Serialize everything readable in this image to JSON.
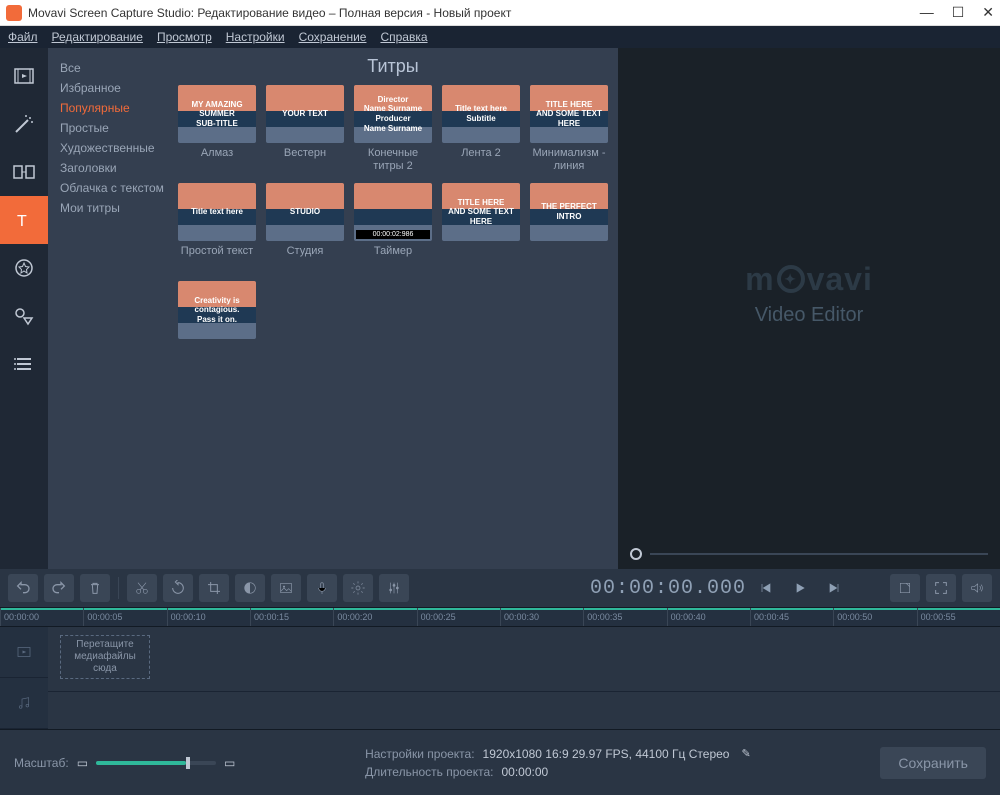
{
  "window": {
    "title": "Movavi Screen Capture Studio: Редактирование видео – Полная версия - Новый проект"
  },
  "menu": [
    "Файл",
    "Редактирование",
    "Просмотр",
    "Настройки",
    "Сохранение",
    "Справка"
  ],
  "rail": [
    {
      "name": "media-icon"
    },
    {
      "name": "wand-icon"
    },
    {
      "name": "transitions-icon"
    },
    {
      "name": "titles-icon",
      "active": true
    },
    {
      "name": "stickers-icon"
    },
    {
      "name": "shapes-icon"
    },
    {
      "name": "list-icon"
    }
  ],
  "categories": {
    "items": [
      "Все",
      "Избранное",
      "Популярные",
      "Простые",
      "Художественные",
      "Заголовки",
      "Облачка с текстом",
      "Мои титры"
    ],
    "selected": 2
  },
  "gallery": {
    "heading": "Титры",
    "thumbs": [
      {
        "overlay": "MY AMAZING SUMMER\\nSUB-TITLE",
        "caption": "Алмаз"
      },
      {
        "overlay": "YOUR TEXT",
        "caption": "Вестерн"
      },
      {
        "overlay": "Director\\nName Surname\\nProducer\\nName Surname",
        "caption": "Конечные титры 2"
      },
      {
        "overlay": "Title text here\\nSubtitle",
        "caption": "Лента 2"
      },
      {
        "overlay": "TITLE HERE\\nAND SOME TEXT HERE",
        "caption": "Минимализм - линия"
      },
      {
        "overlay": "Title text here",
        "caption": "Простой текст"
      },
      {
        "overlay": "STUDIO",
        "caption": "Студия"
      },
      {
        "overlay": "",
        "badge": "00:00:02:986",
        "caption": "Таймер"
      },
      {
        "overlay": "TITLE HERE\\nAND SOME TEXT HERE",
        "caption": ""
      },
      {
        "overlay": "THE PERFECT INTRO",
        "caption": ""
      },
      {
        "overlay": "Creativity is contagious.\\nPass it on.",
        "caption": ""
      }
    ]
  },
  "preview": {
    "brand": "movavi",
    "sub": "Video Editor"
  },
  "clock": "00:00:00.000",
  "ruler": [
    "00:00:00",
    "00:00:05",
    "00:00:10",
    "00:00:15",
    "00:00:20",
    "00:00:25",
    "00:00:30",
    "00:00:35",
    "00:00:40",
    "00:00:45",
    "00:00:50",
    "00:00:55"
  ],
  "dropzone": "Перетащите медиафайлы сюда",
  "status": {
    "zoom_label": "Масштаб:",
    "settings_label": "Настройки проекта:",
    "settings_value": "1920x1080 16:9 29.97 FPS, 44100 Гц Стерео",
    "duration_label": "Длительность проекта:",
    "duration_value": "00:00:00",
    "save": "Сохранить"
  }
}
